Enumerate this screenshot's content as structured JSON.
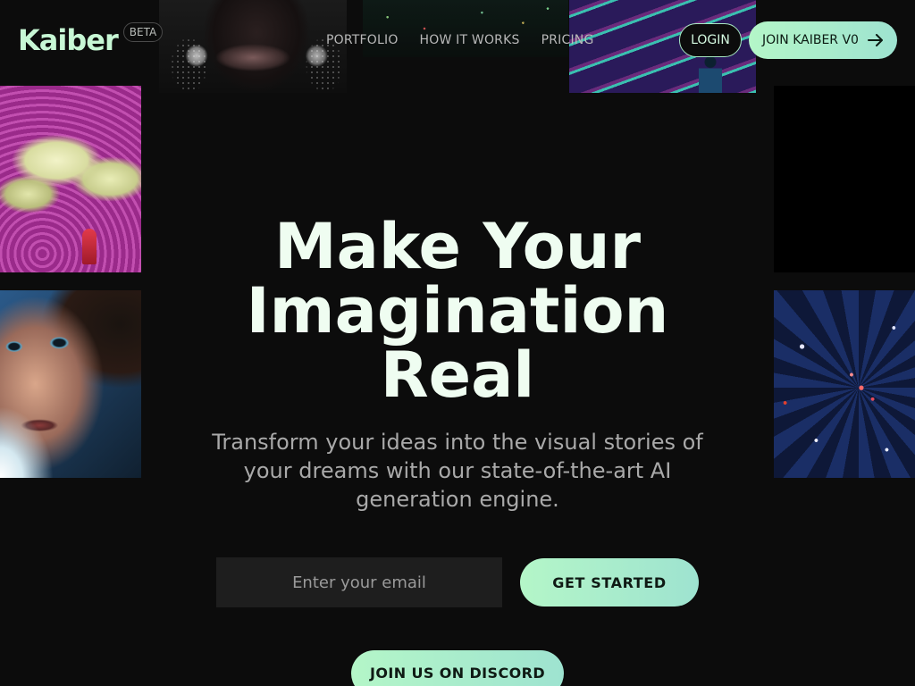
{
  "header": {
    "logo": "Kaiber",
    "badge": "BETA",
    "nav": [
      {
        "label": "PORTFOLIO"
      },
      {
        "label": "HOW IT WORKS"
      },
      {
        "label": "PRICING"
      }
    ],
    "login_label": "LOGIN",
    "join_label": "JOIN KAIBER V0",
    "join_icon": "arrow-right-icon"
  },
  "hero": {
    "title": "Make Your Imagination Real",
    "subtitle": "Transform your ideas into the visual stories of your dreams with our state-of-the-art AI generation engine.",
    "email_placeholder": "Enter your email",
    "email_value": "",
    "cta_label": "GET STARTED",
    "discord_label": "JOIN US ON DISCORD"
  },
  "colors": {
    "background": "#0c0c0c",
    "accent_start": "#b4f6c8",
    "accent_end": "#9ee3d0",
    "logo": "#c7f7d5",
    "title": "#effdf1",
    "subtitle": "#a9a9a9"
  }
}
